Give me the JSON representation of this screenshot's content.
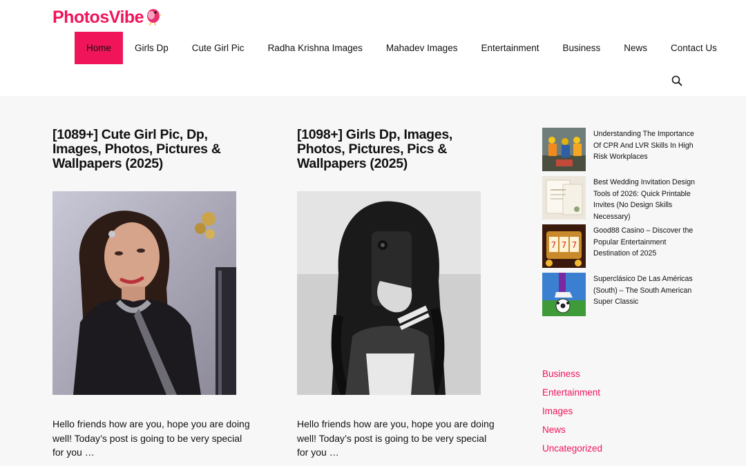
{
  "brand": {
    "logo_part1": "Photos",
    "logo_part2": "Vibe",
    "accent_color": "#f0145a"
  },
  "nav": {
    "items": [
      {
        "label": "Home",
        "active": true
      },
      {
        "label": "Girls Dp"
      },
      {
        "label": "Cute Girl Pic"
      },
      {
        "label": "Radha Krishna Images"
      },
      {
        "label": "Mahadev Images"
      },
      {
        "label": "Entertainment"
      },
      {
        "label": "Business"
      },
      {
        "label": "News"
      },
      {
        "label": "Contact Us"
      }
    ],
    "search_icon": "search-icon"
  },
  "posts": [
    {
      "title": "[1089+] Cute Girl Pic, Dp, Images, Photos, Pictures & Wallpapers (2025)",
      "excerpt": "Hello friends how are you, hope you are doing well! Today’s post is going to be very special for you …"
    },
    {
      "title": "[1098+] Girls Dp, Images, Photos, Pictures, Pics & Wallpapers (2025)",
      "excerpt": "Hello friends how are you, hope you are doing well! Today’s post is going to be very special for you …"
    }
  ],
  "sidebar": {
    "recent": [
      {
        "title": "Understanding The Importance Of CPR And LVR Skills In High Risk Workplaces"
      },
      {
        "title": "Best Wedding Invitation Design Tools of 2026: Quick Printable Invites (No Design Skills Necessary)"
      },
      {
        "title": "Good88 Casino – Discover the Popular Entertainment Destination of 2025"
      },
      {
        "title": "Superclásico De Las Américas (South) – The South American Super Classic"
      }
    ],
    "categories": [
      "Business",
      "Entertainment",
      "Images",
      "News",
      "Uncategorized"
    ]
  }
}
